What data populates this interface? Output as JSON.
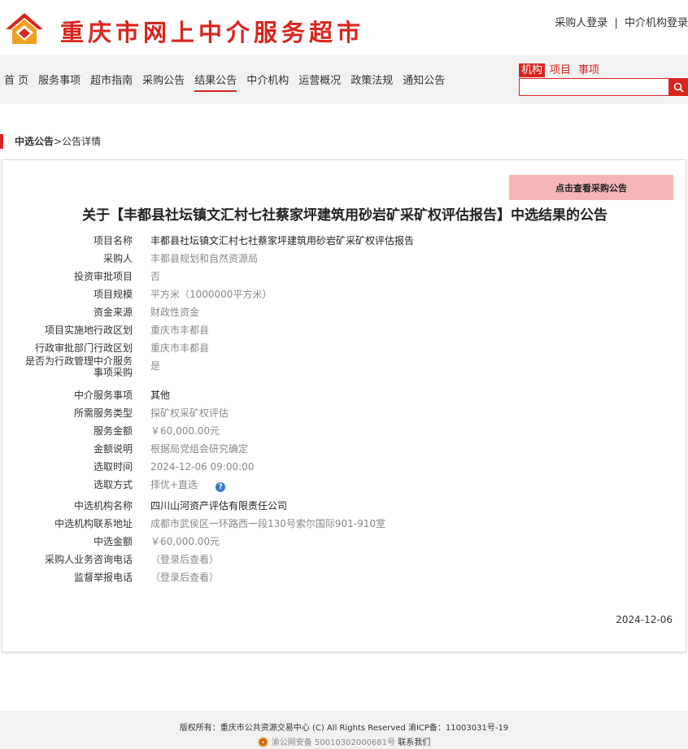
{
  "header": {
    "site_title": "重庆市网上中介服务超市",
    "buyer_login": "采购人登录",
    "separator": "|",
    "agency_login": "中介机构登录"
  },
  "nav": {
    "items": [
      "首 页",
      "服务事项",
      "超市指南",
      "采购公告",
      "结果公告",
      "中介机构",
      "运营概况",
      "政策法规",
      "通知公告"
    ],
    "active_index": 4
  },
  "search": {
    "tabs": [
      "机构",
      "项目",
      "事项"
    ],
    "active_tab": 0,
    "value": ""
  },
  "breadcrumb": {
    "first": "中选公告",
    "separator": ">",
    "current": "公告详情"
  },
  "notice": {
    "view_button": "点击查看采购公告",
    "title": "关于【丰都县社坛镇文汇村七社蔡家坪建筑用砂岩矿采矿权评估报告】中选结果的公告",
    "rows": [
      {
        "label": "项目名称",
        "value": "丰都县社坛镇文汇村七社蔡家坪建筑用砂岩矿采矿权评估报告",
        "dark": true
      },
      {
        "label": "采购人",
        "value": "丰都县规划和自然资源局",
        "dark": false
      },
      {
        "label": "投资审批项目",
        "value": "否",
        "dark": false
      },
      {
        "label": "项目规模",
        "value": "平方米（1000000平方米）",
        "dark": false
      },
      {
        "label": "资金来源",
        "value": "财政性资金",
        "dark": false
      },
      {
        "label": "项目实施地行政区划",
        "value": "重庆市丰都县",
        "dark": false
      },
      {
        "label": "行政审批部门行政区划",
        "value": "重庆市丰都县",
        "dark": false
      },
      {
        "label": "是否为行政管理中介服务事项采购",
        "value": "是",
        "dark": false
      },
      {
        "label": "中介服务事项",
        "value": "其他",
        "dark": true
      },
      {
        "label": "所需服务类型",
        "value": "探矿权采矿权评估",
        "dark": false
      },
      {
        "label": "服务金额",
        "value": "￥60,000.00元",
        "dark": false
      },
      {
        "label": "金额说明",
        "value": "根据局党组会研究确定",
        "dark": false
      },
      {
        "label": "选取时间",
        "value": "2024-12-06 09:00:00",
        "dark": false
      },
      {
        "label": "选取方式",
        "value": "择优+直选",
        "dark": false
      },
      {
        "label": "中选机构名称",
        "value": "四川山河资产评估有限责任公司",
        "dark": true
      },
      {
        "label": "中选机构联系地址",
        "value": "成都市武侯区一环路西一段130号索尔国际901-910室",
        "dark": false
      },
      {
        "label": "中选金额",
        "value": "￥60,000.00元",
        "dark": false
      },
      {
        "label": "采购人业务咨询电话",
        "value": "（登录后查看）",
        "dark": false
      },
      {
        "label": "监督举报电话",
        "value": "（登录后查看）",
        "dark": false
      }
    ],
    "help_icon_glyph": "?",
    "publish_date": "2024-12-06"
  },
  "footer": {
    "copyright": "版权所有：重庆市公共资源交易中心 (C) All Rights Reserved 渝ICP备：11003031号-19",
    "police_record": "渝公网安备 50010302000681号",
    "contact": "联系我们"
  },
  "colors": {
    "brand_red": "#d8261f",
    "button_pink": "#f4b6b6",
    "help_blue": "#3a7bd5"
  }
}
